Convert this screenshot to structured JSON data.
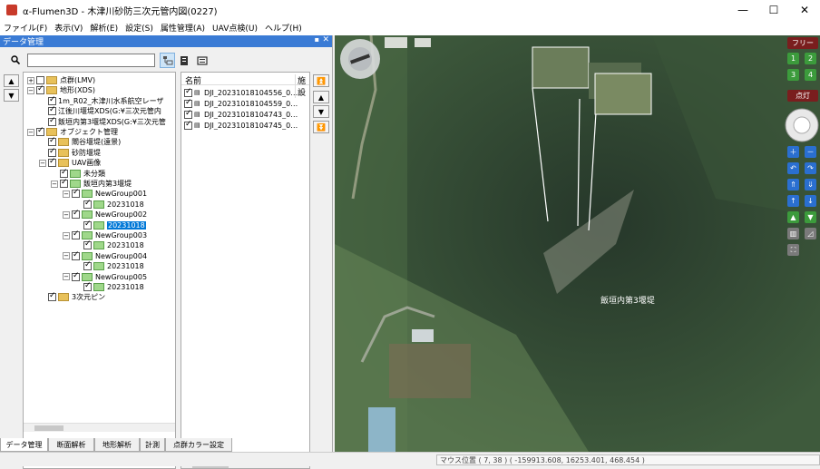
{
  "window": {
    "title": "α-Flumen3D - 木津川砂防三次元管内図(0227)",
    "minimize_glyph": "—",
    "maximize_glyph": "☐",
    "close_glyph": "✕"
  },
  "menu": [
    "ファイル(F)",
    "表示(V)",
    "解析(E)",
    "設定(S)",
    "属性管理(A)",
    "UAV点検(U)",
    "ヘルプ(H)"
  ],
  "panel": {
    "title": "データ管理",
    "pin_glyph": "▪",
    "close_glyph": "✕",
    "search_placeholder": "",
    "up_glyph": "▲",
    "down_glyph": "▼"
  },
  "tree": [
    {
      "label": "点群(LMV)",
      "expander": "+",
      "checked": false,
      "folder": "yellow"
    },
    {
      "label": "地形(XDS)",
      "expander": "−",
      "checked": true,
      "folder": "yellow"
    },
    {
      "label": "1m_R02_木津川水系航空レーザ",
      "expander": "",
      "checked": true,
      "folder": ""
    },
    {
      "label": "江後川堰堤XDS(G:¥三次元管内",
      "expander": "",
      "checked": true,
      "folder": ""
    },
    {
      "label": "飯垣内第3堰堤XDS(G:¥三次元管",
      "expander": "",
      "checked": true,
      "folder": ""
    },
    {
      "label": "オブジェクト管理",
      "expander": "−",
      "checked": true,
      "folder": "yellow"
    },
    {
      "label": "閘谷堰堤(遠景)",
      "expander": "",
      "checked": true,
      "folder": "yellow"
    },
    {
      "label": "砂防堰堤",
      "expander": "",
      "checked": true,
      "folder": "yellow"
    },
    {
      "label": "UAV画像",
      "expander": "−",
      "checked": true,
      "folder": "yellow"
    },
    {
      "label": "未分類",
      "expander": "",
      "checked": true,
      "folder": "green"
    },
    {
      "label": "飯垣内第3堰堤",
      "expander": "−",
      "checked": true,
      "folder": "green"
    },
    {
      "label": "NewGroup001",
      "expander": "−",
      "checked": true,
      "folder": "green"
    },
    {
      "label": "20231018",
      "expander": "",
      "checked": true,
      "folder": "green"
    },
    {
      "label": "NewGroup002",
      "expander": "−",
      "checked": true,
      "folder": "green"
    },
    {
      "label": "20231018",
      "expander": "",
      "checked": true,
      "folder": "green",
      "selected": true
    },
    {
      "label": "NewGroup003",
      "expander": "−",
      "checked": true,
      "folder": "green"
    },
    {
      "label": "20231018",
      "expander": "",
      "checked": true,
      "folder": "green"
    },
    {
      "label": "NewGroup004",
      "expander": "−",
      "checked": true,
      "folder": "green"
    },
    {
      "label": "20231018",
      "expander": "",
      "checked": true,
      "folder": "green"
    },
    {
      "label": "NewGroup005",
      "expander": "−",
      "checked": true,
      "folder": "green"
    },
    {
      "label": "20231018",
      "expander": "",
      "checked": true,
      "folder": "green"
    },
    {
      "label": "3次元ピン",
      "expander": "",
      "checked": true,
      "folder": "yellow"
    }
  ],
  "list": {
    "col_name": "名前",
    "col_second": "施設",
    "rows": [
      {
        "name": "DJI_20231018104556_0…",
        "value": "-"
      },
      {
        "name": "DJI_20231018104559_0…",
        "value": "-"
      },
      {
        "name": "DJI_20231018104743_0…",
        "value": "-"
      },
      {
        "name": "DJI_20231018104745_0…",
        "value": "-"
      }
    ],
    "side_buttons": [
      "⏫",
      "▲",
      "▼",
      "⏬"
    ]
  },
  "tabs": [
    "データ管理",
    "断面解析",
    "地形解析",
    "計測",
    "点群カラー設定"
  ],
  "viewport": {
    "map_label": "飯垣内第3堰堤",
    "free_button": "フリー",
    "point_button": "点灯",
    "num_buttons": [
      "1",
      "2",
      "3",
      "4"
    ]
  },
  "status": {
    "mouse_position": "マウス位置 ( 7, 38 ) ( -159913.608, 16253.401, 468.454 )"
  },
  "colors": {
    "accent": "#3a7bd5",
    "selection": "#0078d7"
  }
}
